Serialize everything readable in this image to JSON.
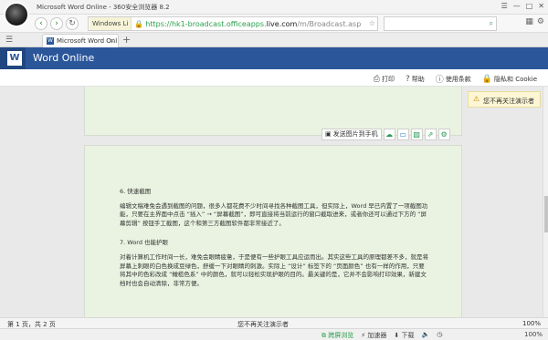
{
  "window": {
    "title": "Microsoft Word Online - 360安全浏览器 8.2",
    "controls": [
      "☰",
      "—",
      "□",
      "✕"
    ]
  },
  "addressbar": {
    "mode_badge": "Windows Li",
    "url_prefix": "https://hk1-broadcast.officeapps.",
    "url_host": "live.com",
    "url_path": "/m/Broadcast.asp"
  },
  "tab": {
    "label": "Microsoft Word Onl",
    "close": "×",
    "new_tab": "+"
  },
  "app": {
    "logo": "W",
    "title": "Word Online"
  },
  "commands": {
    "print": "打印",
    "help": "帮助",
    "terms": "使用条款",
    "privacy": "隐私和 Cookie"
  },
  "page_toolbar": {
    "send_to_phone": "发送图片到手机"
  },
  "notice": {
    "text": "您不再关注演示者"
  },
  "document": {
    "items": [
      {
        "heading": "6.    快速截图",
        "body": "编辑文稿难免会遇到截图的问题，很多人都花费不少时间寻找各种截图工具，但实际上，Word 早已内置了一项截图功能，只要在主界面中点击 “插入” → “屏幕截图”，即可直接将当前运行的窗口截取进来，或者你还可以通过下方的 “屏幕剪辑” 按钮手工截图，这个和第三方截图软件都非常接近了。"
      },
      {
        "heading": "7.    Word 也能护眼",
        "body": "对着计算机工作时间一长，难免会眼睛疲惫，于是便有一些护眼工具应运而出。其实这些工具的原理都差不多，就是将屏幕上刺眼的白色换成豆绿色，舒缓一下对眼睛的刺激。实际上 “设计” 标签下的 “页面颜色” 也有一样的作用，只要将其中的色彩改成 “橄榄色系” 中的颜色，就可以轻松实现护眼的目的。最关键的是，它并不会影响打印效果，新建文档时也会自动清除，非常方便。"
      }
    ]
  },
  "statusbar": {
    "pages": "第 1 页，共 2 页",
    "middle": "您不再关注演示者",
    "zoom": "100%"
  },
  "browser_status": {
    "items": [
      "跨屏浏览",
      "加速器",
      "下载",
      "",
      ""
    ],
    "zoom": "100%"
  }
}
